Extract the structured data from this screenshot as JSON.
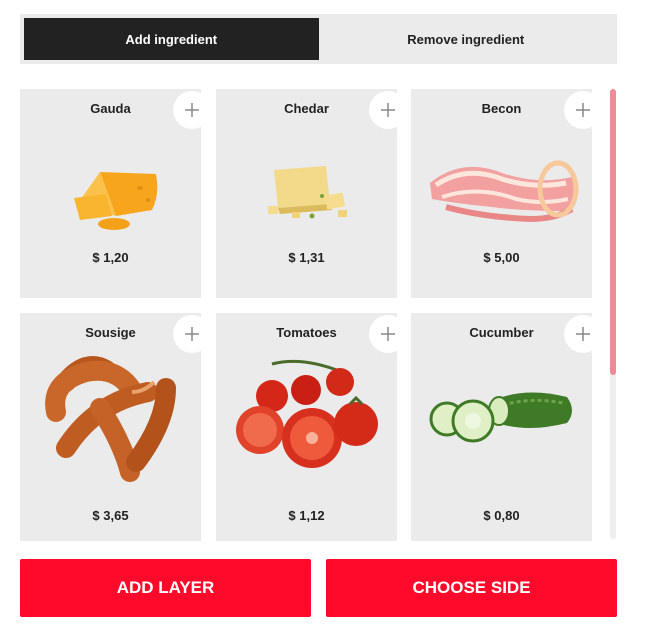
{
  "tabs": [
    {
      "label": "Add ingredient",
      "active": true
    },
    {
      "label": "Remove ingredient",
      "active": false
    }
  ],
  "ingredients": [
    {
      "name": "Gauda",
      "price": "$ 1,20",
      "image": "cheese-wedge-image"
    },
    {
      "name": "Chedar",
      "price": "$ 1,31",
      "image": "parmesan-image"
    },
    {
      "name": "Becon",
      "price": "$ 5,00",
      "image": "bacon-image"
    },
    {
      "name": "Sousige",
      "price": "$ 3,65",
      "image": "sausages-image"
    },
    {
      "name": "Tomatoes",
      "price": "$ 1,12",
      "image": "tomatoes-image"
    },
    {
      "name": "Cucumber",
      "price": "$ 0,80",
      "image": "cucumber-image"
    }
  ],
  "actions": {
    "add_layer": "ADD LAYER",
    "choose_side": "CHOOSE SIDE"
  },
  "colors": {
    "accent": "#ff0a2b",
    "tab_active_bg": "#222222",
    "card_bg": "#ebebeb",
    "scroll_thumb": "#f08a95"
  }
}
